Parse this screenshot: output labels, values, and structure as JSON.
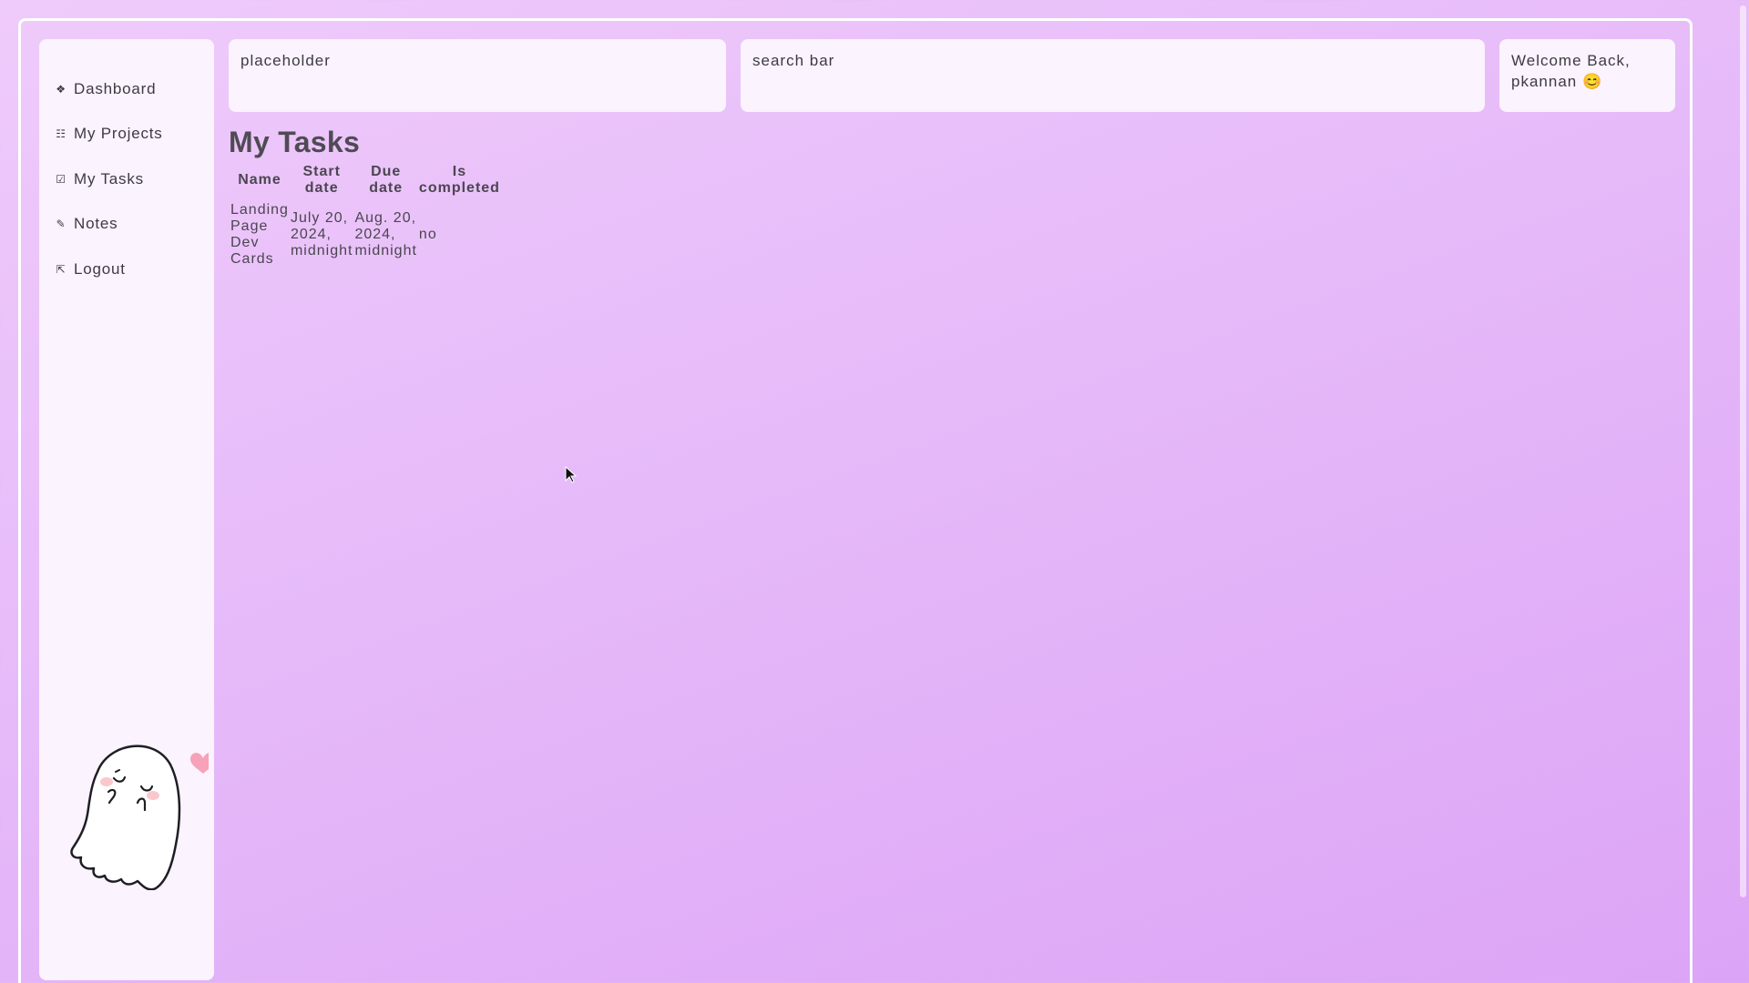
{
  "sidebar": {
    "items": [
      {
        "label": "Dashboard",
        "icon": "◆ dashboard-icon",
        "glyph": "❖"
      },
      {
        "label": "My Projects",
        "icon": "projects-list-icon",
        "glyph": "☷"
      },
      {
        "label": "My Tasks",
        "icon": "checkbox-icon",
        "glyph": "☑"
      },
      {
        "label": "Notes",
        "icon": "pencil-icon",
        "glyph": "✎"
      },
      {
        "label": "Logout",
        "icon": "logout-arrow-icon",
        "glyph": "⇱"
      }
    ]
  },
  "header": {
    "placeholder_text": "placeholder",
    "search_text": "search bar",
    "welcome_line1": "Welcome Back,",
    "welcome_line2": "pkannan 😊"
  },
  "main": {
    "title": "My Tasks",
    "table": {
      "columns": [
        {
          "line1": "Name",
          "line2": ""
        },
        {
          "line1": "Start",
          "line2": "date"
        },
        {
          "line1": "Due",
          "line2": "date"
        },
        {
          "line1": "Is",
          "line2": "completed"
        }
      ],
      "rows": [
        {
          "name": [
            "Landing",
            "Page",
            "Dev",
            "Cards"
          ],
          "start_date": [
            "July 20,",
            "2024,",
            "midnight"
          ],
          "due_date": [
            "Aug. 20,",
            "2024,",
            "midnight"
          ],
          "is_completed": "no"
        }
      ]
    }
  },
  "colors": {
    "background_top": "#efcbfb",
    "background_bottom": "#dca4f6",
    "panel": "#fbf3fd",
    "heart": "#f7a2b8",
    "blush": "#f9c8cc"
  }
}
